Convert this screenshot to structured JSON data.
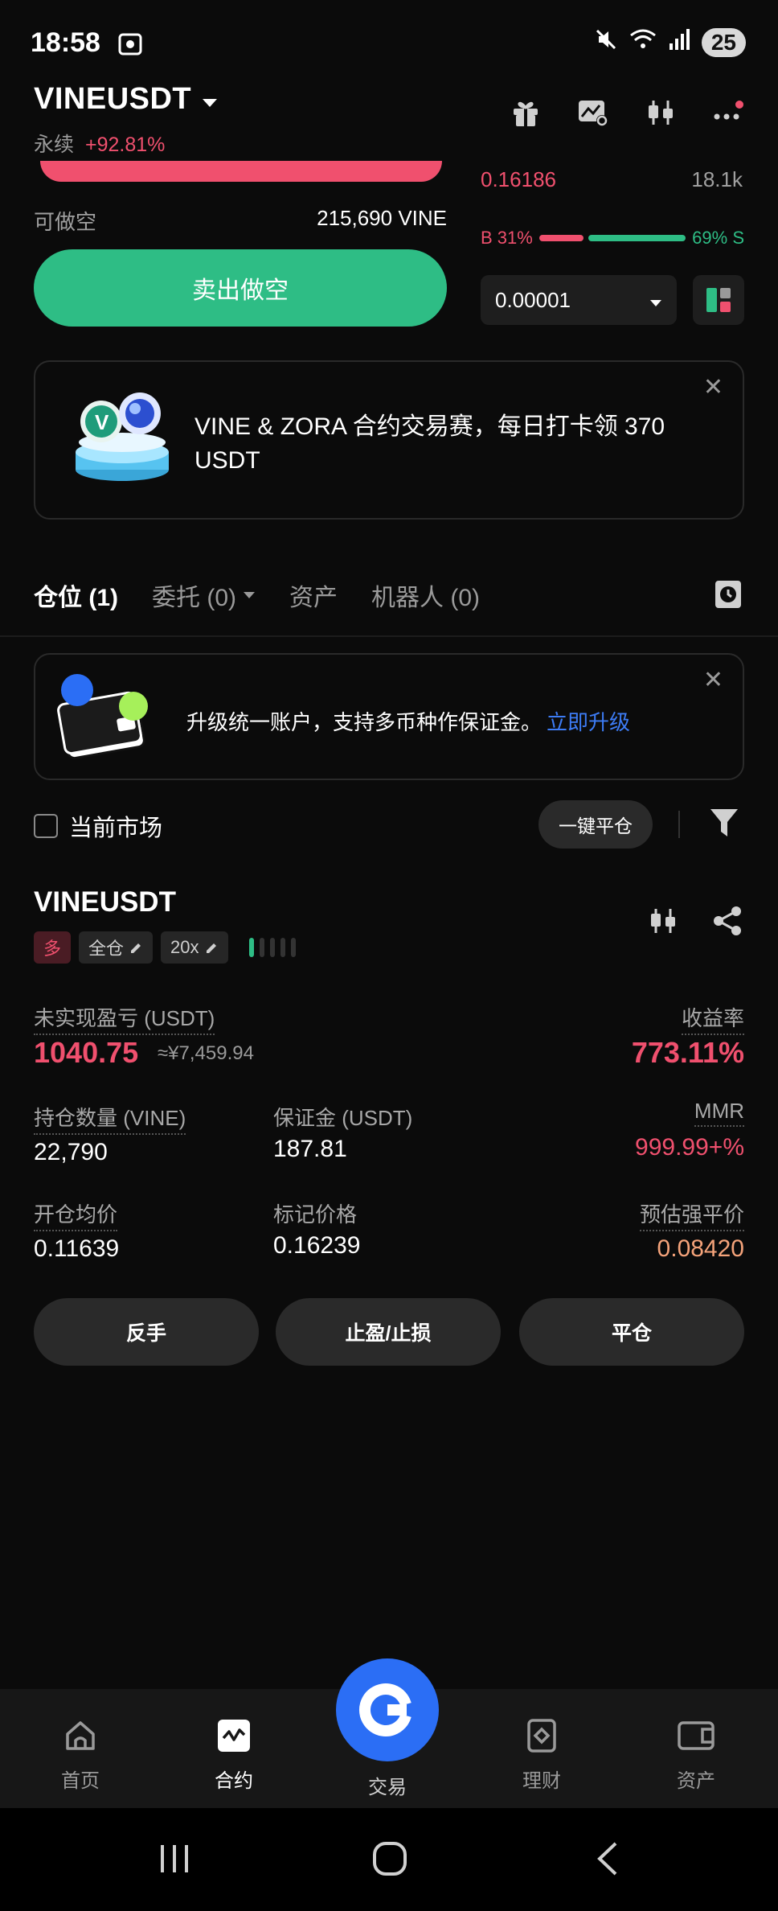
{
  "status": {
    "time": "18:58",
    "battery": "25"
  },
  "header": {
    "pair": "VINEUSDT",
    "type": "永续",
    "change": "+92.81%"
  },
  "order": {
    "avail_label": "可做空",
    "avail_value": "215,690 VINE",
    "sell_label": "卖出做空",
    "ob_price": "0.16186",
    "ob_qty": "18.1k",
    "ratio_b": "B 31%",
    "ratio_s": "69% S",
    "buy_ratio": 0.31,
    "precision": "0.00001"
  },
  "promo": {
    "text": "VINE & ZORA 合约交易赛，每日打卡领 370 USDT"
  },
  "tabs": {
    "positions": "仓位 (1)",
    "orders": "委托 (0)",
    "assets": "资产",
    "bots": "机器人 (0)"
  },
  "upgrade": {
    "text": "升级统一账户，支持多币种作保证金。",
    "link": "立即升级"
  },
  "filter": {
    "current_market": "当前市场",
    "close_all": "一键平仓"
  },
  "position": {
    "symbol": "VINEUSDT",
    "side": "多",
    "margin_mode": "全仓",
    "leverage": "20x",
    "pnl_label": "未实现盈亏 (USDT)",
    "pnl_value": "1040.75",
    "pnl_cny": "≈¥7,459.94",
    "roe_label": "收益率",
    "roe_value": "773.11%",
    "qty_label": "持仓数量 (VINE)",
    "qty_value": "22,790",
    "margin_label": "保证金 (USDT)",
    "margin_value": "187.81",
    "mmr_label": "MMR",
    "mmr_value": "999.99+%",
    "entry_label": "开仓均价",
    "entry_value": "0.11639",
    "mark_label": "标记价格",
    "mark_value": "0.16239",
    "liq_label": "预估强平价",
    "liq_value": "0.08420"
  },
  "actions": {
    "reverse": "反手",
    "tpsl": "止盈/止损",
    "close": "平仓"
  },
  "nav": {
    "home": "首页",
    "futures": "合约",
    "trade": "交易",
    "earn": "理财",
    "assets": "资产"
  },
  "colors": {
    "red": "#f0506e",
    "green": "#2ebd85",
    "blue": "#2b6ef5",
    "orange": "#f5a37a"
  }
}
